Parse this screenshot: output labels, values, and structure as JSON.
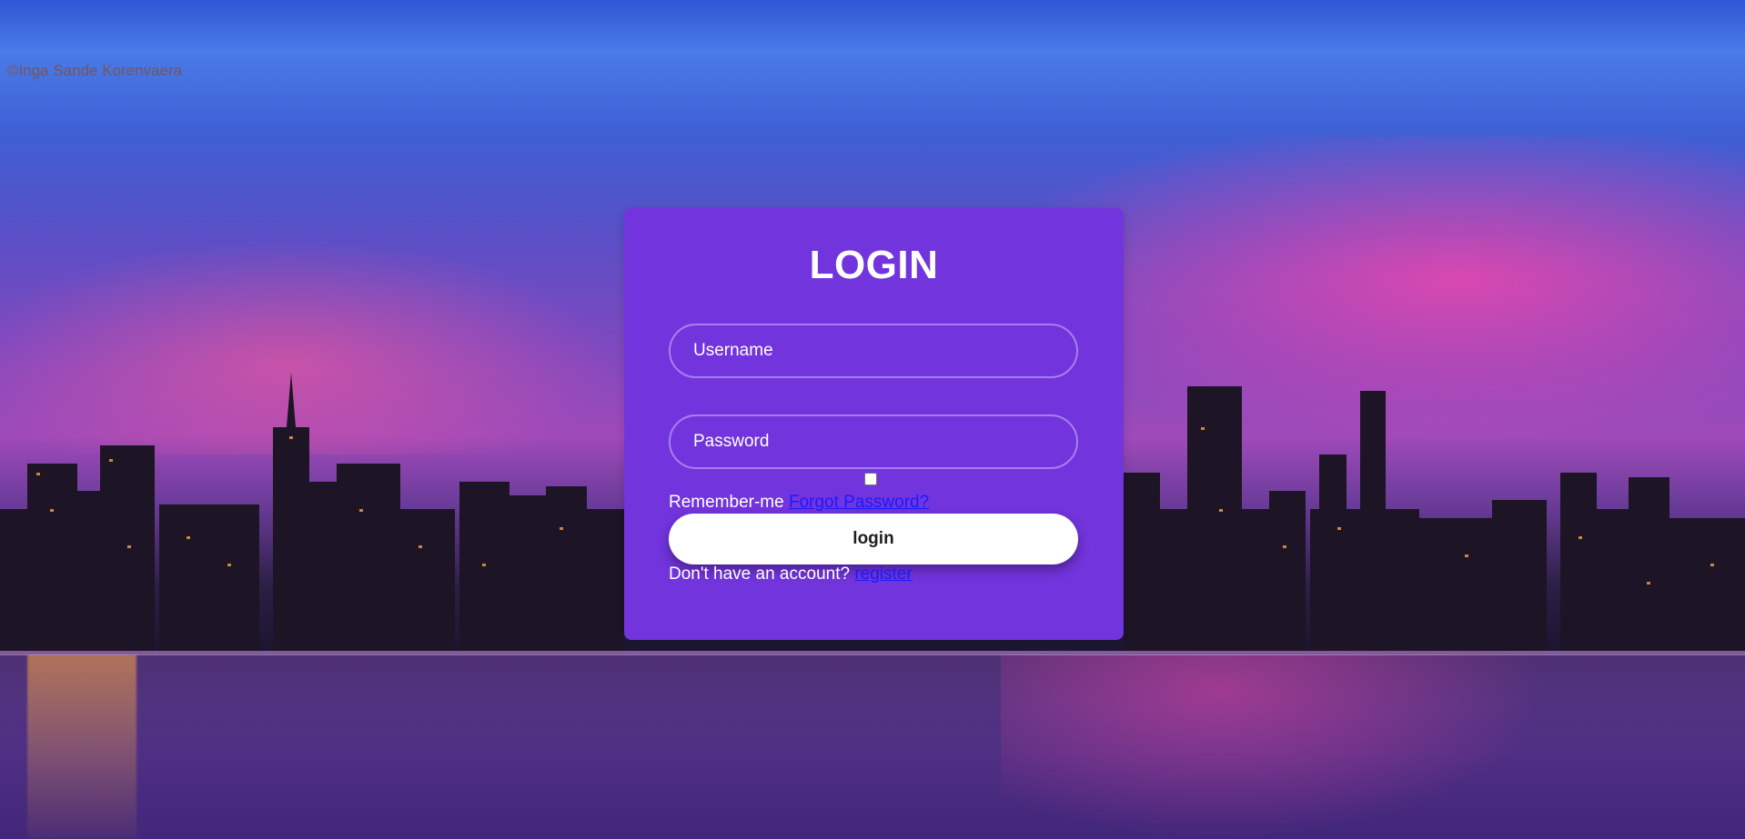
{
  "background": {
    "credit": "©Inga Sande Korenvaera"
  },
  "login_card": {
    "title": "LOGIN",
    "username_placeholder": "Username",
    "password_placeholder": "Password",
    "remember_label": "Remember-me",
    "forgot_link": "Forgot Password?",
    "login_button": "login",
    "register_prompt": "Don't have an account?",
    "register_link": "register"
  },
  "colors": {
    "card": "#7234dc",
    "link": "#1a1aff"
  }
}
